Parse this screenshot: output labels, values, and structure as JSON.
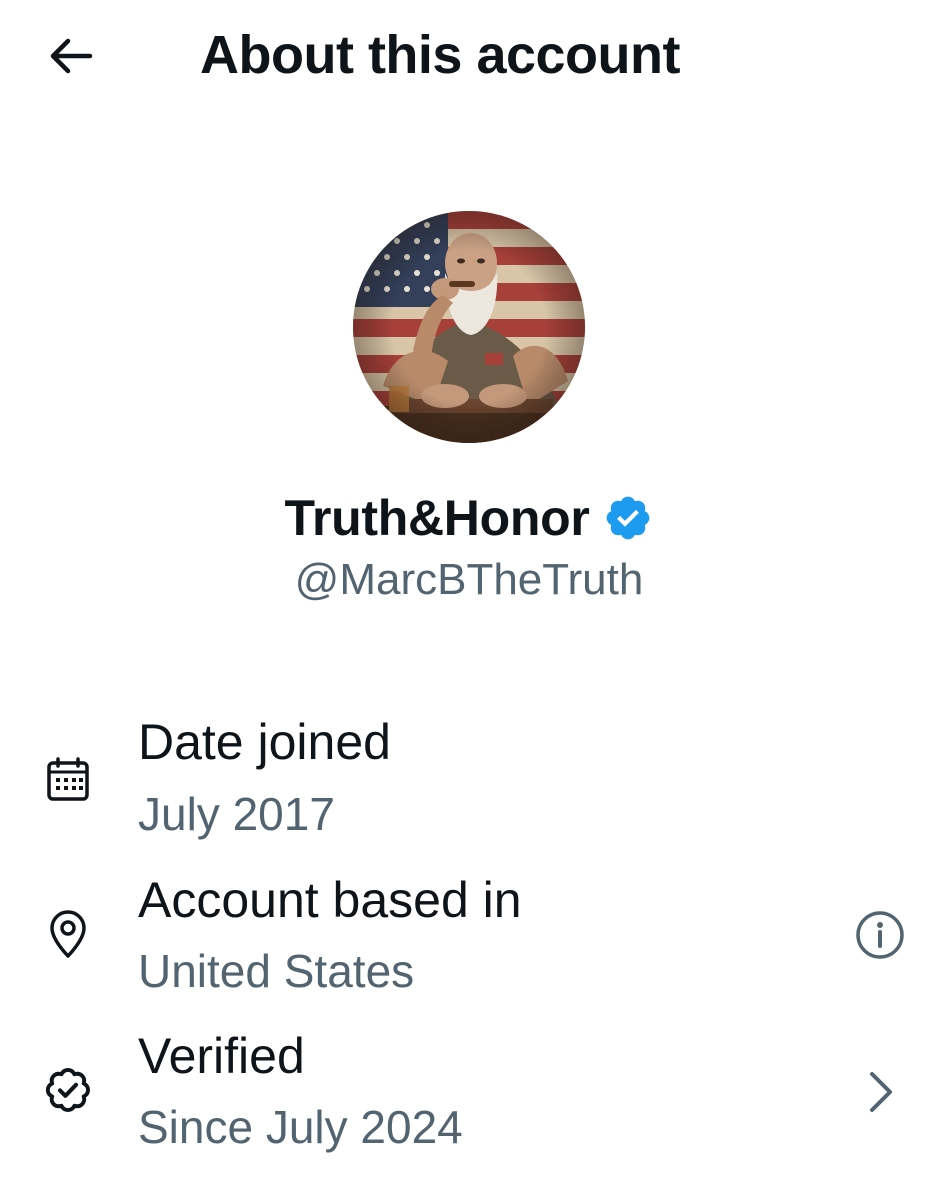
{
  "header": {
    "title": "About this account",
    "back_icon": "arrow-left-icon"
  },
  "profile": {
    "display_name": "Truth&Honor",
    "handle": "@MarcBTheTruth",
    "verified_badge_icon": "verified-badge-icon",
    "avatar_description_icon": "avatar-image",
    "badge_color": "#1d9bf0"
  },
  "details": [
    {
      "icon": "calendar-icon",
      "label": "Date joined",
      "value": "July 2017"
    },
    {
      "icon": "location-pin-icon",
      "label": "Account based in",
      "value": "United States",
      "action_icon": "info-icon"
    },
    {
      "icon": "verified-check-icon",
      "label": "Verified",
      "value": "Since July 2024",
      "action_icon": "chevron-right-icon"
    }
  ],
  "colors": {
    "primary_text": "#0f1419",
    "secondary_text": "#536471",
    "background": "#ffffff"
  }
}
